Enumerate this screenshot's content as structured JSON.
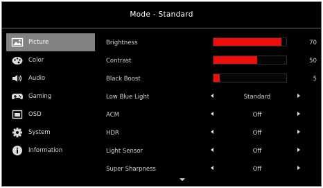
{
  "header": {
    "title": "Mode - Standard"
  },
  "sidebar": {
    "items": [
      {
        "label": "Picture",
        "icon": "picture-icon",
        "selected": true
      },
      {
        "label": "Color",
        "icon": "palette-icon",
        "selected": false
      },
      {
        "label": "Audio",
        "icon": "speaker-icon",
        "selected": false
      },
      {
        "label": "Gaming",
        "icon": "gamepad-icon",
        "selected": false
      },
      {
        "label": "OSD",
        "icon": "osd-icon",
        "selected": false
      },
      {
        "label": "System",
        "icon": "gear-icon",
        "selected": false
      },
      {
        "label": "Information",
        "icon": "info-icon",
        "selected": false
      }
    ]
  },
  "settings": {
    "sliders": [
      {
        "label": "Brightness",
        "value": "70",
        "level": 0.93
      },
      {
        "label": "Contrast",
        "value": "50",
        "level": 0.6
      },
      {
        "label": "Black Boost",
        "value": "5",
        "level": 0.09
      }
    ],
    "options": [
      {
        "label": "Low Blue Light",
        "value": "Standard"
      },
      {
        "label": "ACM",
        "value": "Off"
      },
      {
        "label": "HDR",
        "value": "Off"
      },
      {
        "label": "Light Sensor",
        "value": "Off"
      },
      {
        "label": "Super Sharpness",
        "value": "Off"
      }
    ]
  },
  "colors": {
    "background": "#000000",
    "selected_tab": "#828282",
    "slider_fill": "#ee0c0c",
    "border": "#6a6a6a"
  },
  "more_indicator_icon": "chevron-down-icon"
}
